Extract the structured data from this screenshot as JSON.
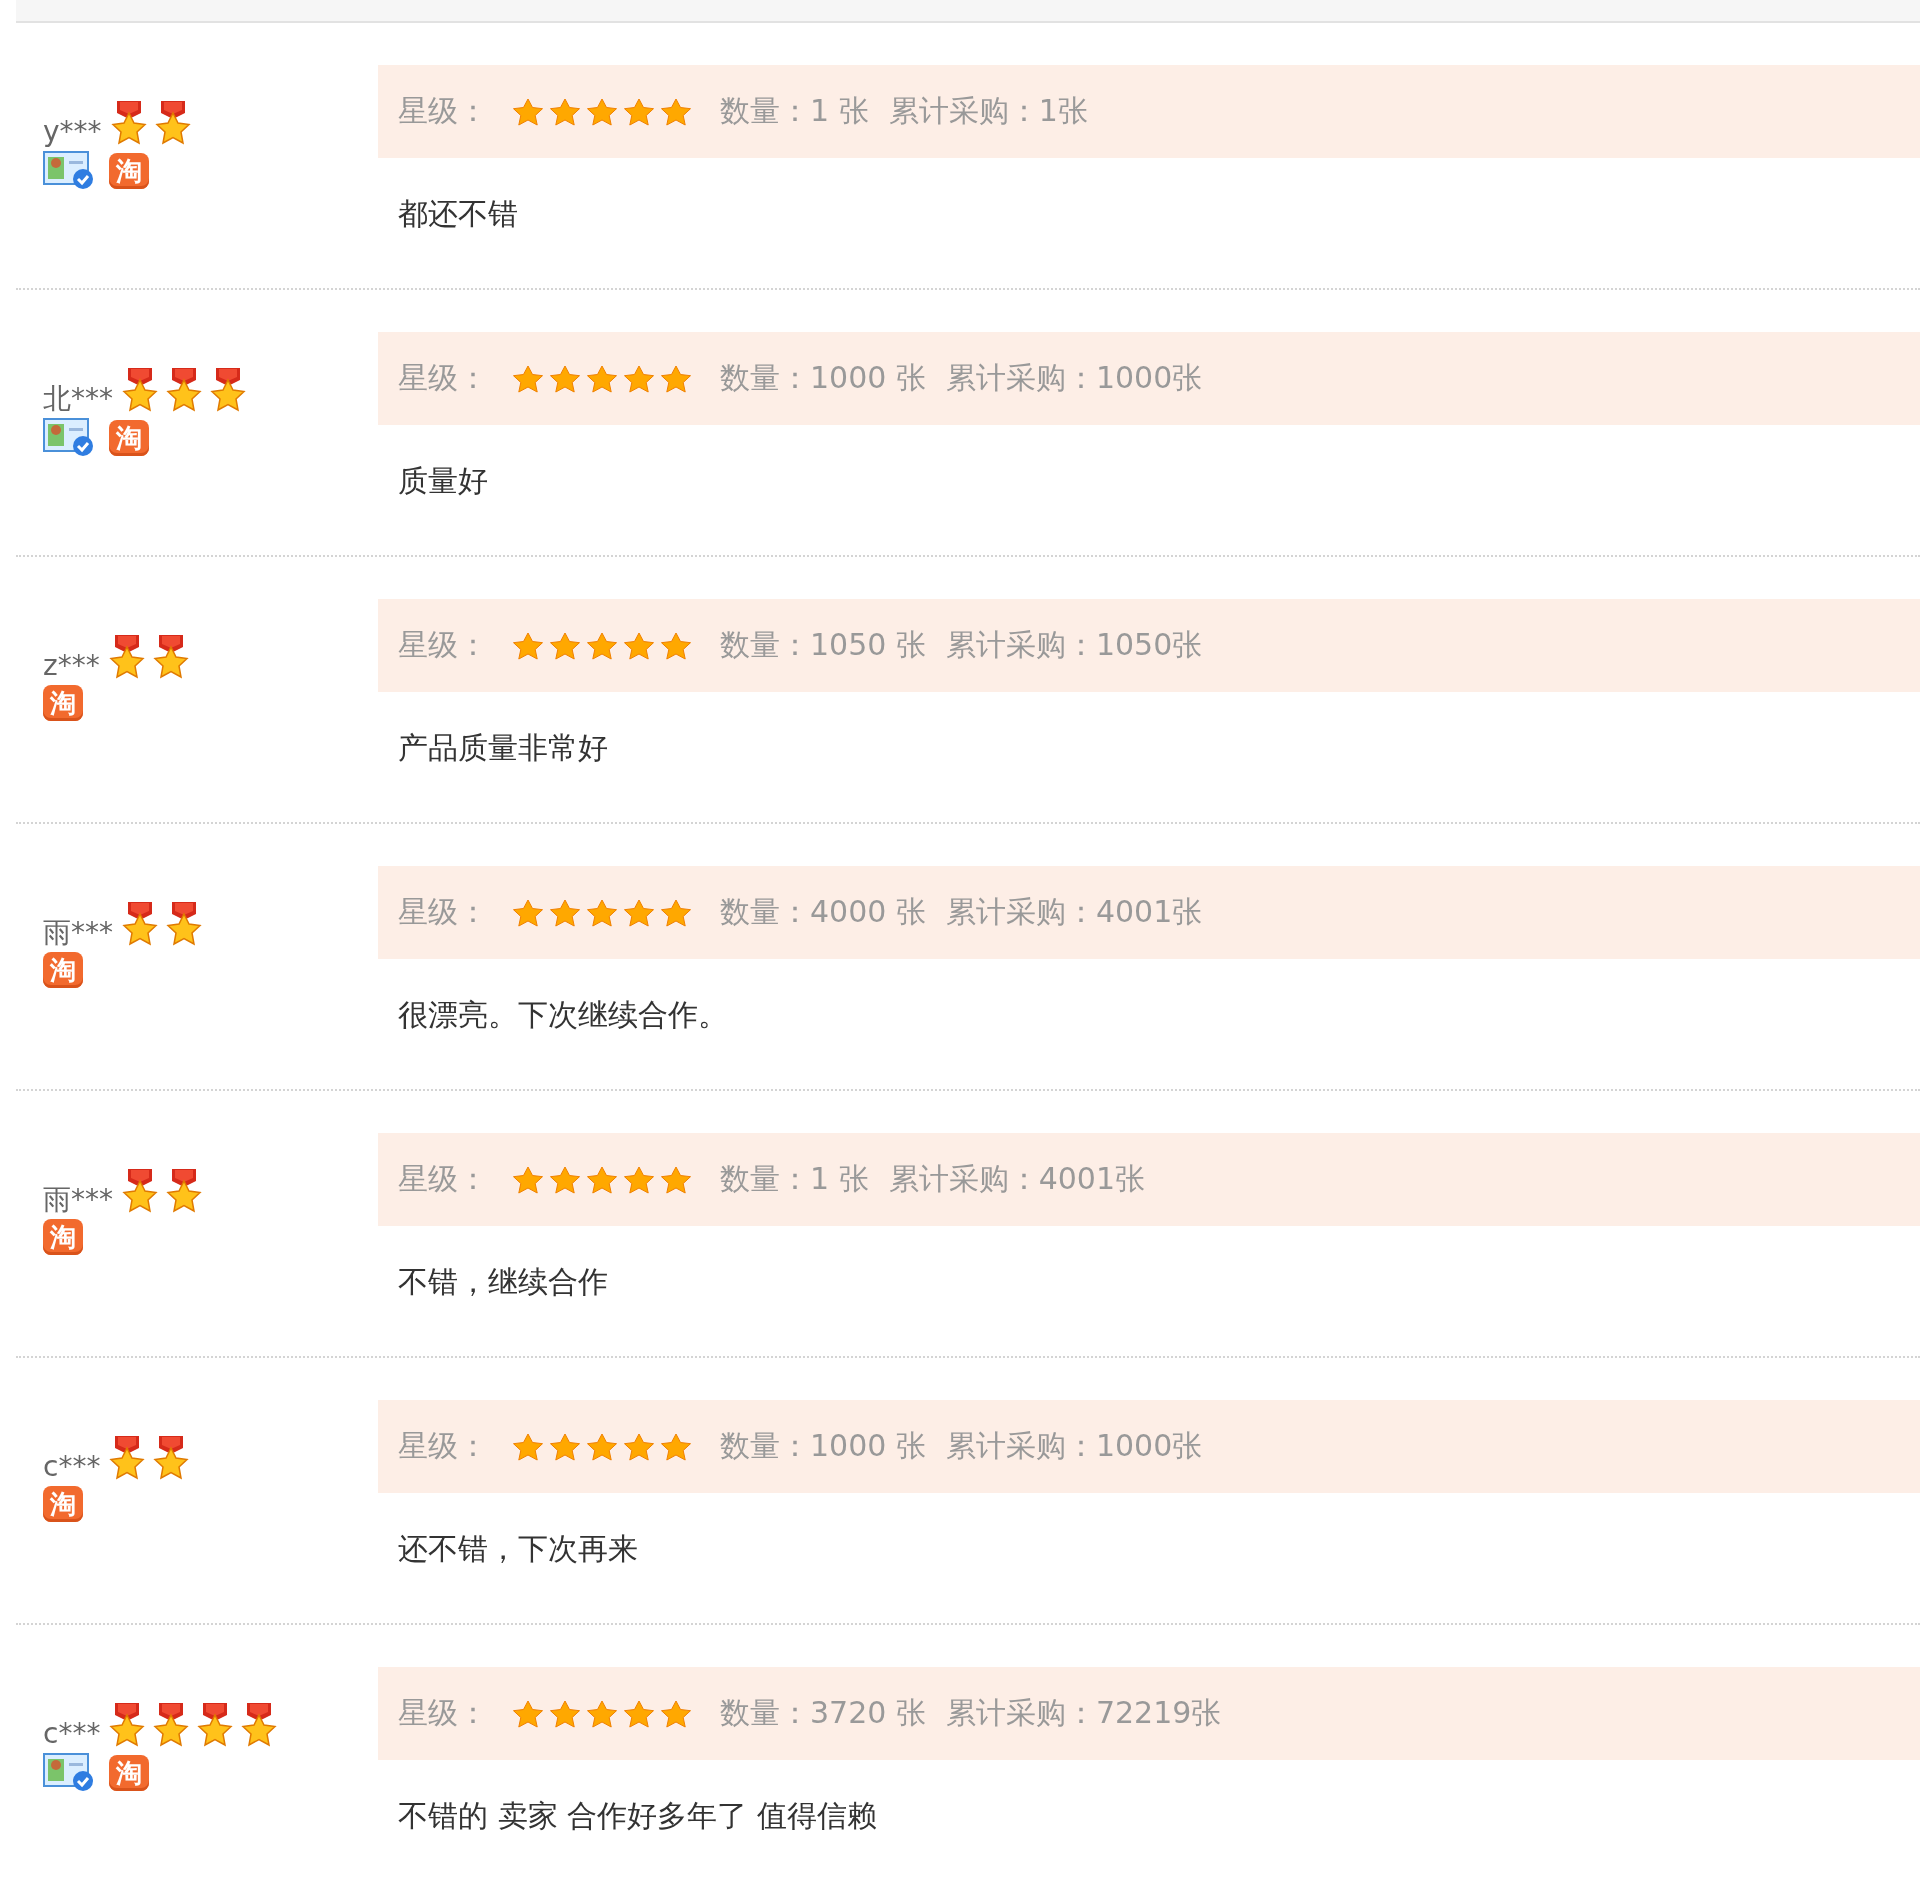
{
  "reviews": [
    {
      "user": "y***",
      "medals": [
        {
          "kind": "medal"
        },
        {
          "kind": "medal"
        }
      ],
      "verified": true,
      "shop_badge": "淘",
      "rating_label": "星级：",
      "rating": {
        "stars": 5
      },
      "quantity": "数量：1 张",
      "total": "累计采购：1张",
      "comment": "都还不错"
    },
    {
      "user": "北***",
      "medals": [
        {
          "kind": "medal"
        },
        {
          "kind": "medal"
        },
        {
          "kind": "medal"
        }
      ],
      "verified": true,
      "shop_badge": "淘",
      "rating_label": "星级：",
      "rating": {
        "stars": 5
      },
      "quantity": "数量：1000 张",
      "total": "累计采购：1000张",
      "comment": "质量好"
    },
    {
      "user": "z***",
      "medals": [
        {
          "kind": "medal"
        },
        {
          "kind": "medal"
        }
      ],
      "verified": false,
      "shop_badge": "淘",
      "rating_label": "星级：",
      "rating": {
        "stars": 5
      },
      "quantity": "数量：1050 张",
      "total": "累计采购：1050张",
      "comment": "产品质量非常好"
    },
    {
      "user": "雨***",
      "medals": [
        {
          "kind": "medal"
        },
        {
          "kind": "medal"
        }
      ],
      "verified": false,
      "shop_badge": "淘",
      "rating_label": "星级：",
      "rating": {
        "stars": 5
      },
      "quantity": "数量：4000 张",
      "total": "累计采购：4001张",
      "comment": "很漂亮。下次继续合作。"
    },
    {
      "user": "雨***",
      "medals": [
        {
          "kind": "medal"
        },
        {
          "kind": "medal"
        }
      ],
      "verified": false,
      "shop_badge": "淘",
      "rating_label": "星级：",
      "rating": {
        "stars": 5
      },
      "quantity": "数量：1 张",
      "total": "累计采购：4001张",
      "comment": "不错，继续合作"
    },
    {
      "user": "c***",
      "medals": [
        {
          "kind": "medal"
        },
        {
          "kind": "medal"
        }
      ],
      "verified": false,
      "shop_badge": "淘",
      "rating_label": "星级：",
      "rating": {
        "stars": 5
      },
      "quantity": "数量：1000 张",
      "total": "累计采购：1000张",
      "comment": "还不错，下次再来"
    },
    {
      "user": "c***",
      "medals": [
        {
          "kind": "medal"
        },
        {
          "kind": "medal"
        },
        {
          "kind": "medal"
        },
        {
          "kind": "medal"
        }
      ],
      "verified": true,
      "shop_badge": "淘",
      "rating_label": "星级：",
      "rating": {
        "stars": 5
      },
      "quantity": "数量：3720 张",
      "total": "累计采购：72219张",
      "comment": "不错的 卖家 合作好多年了 值得信赖"
    }
  ]
}
